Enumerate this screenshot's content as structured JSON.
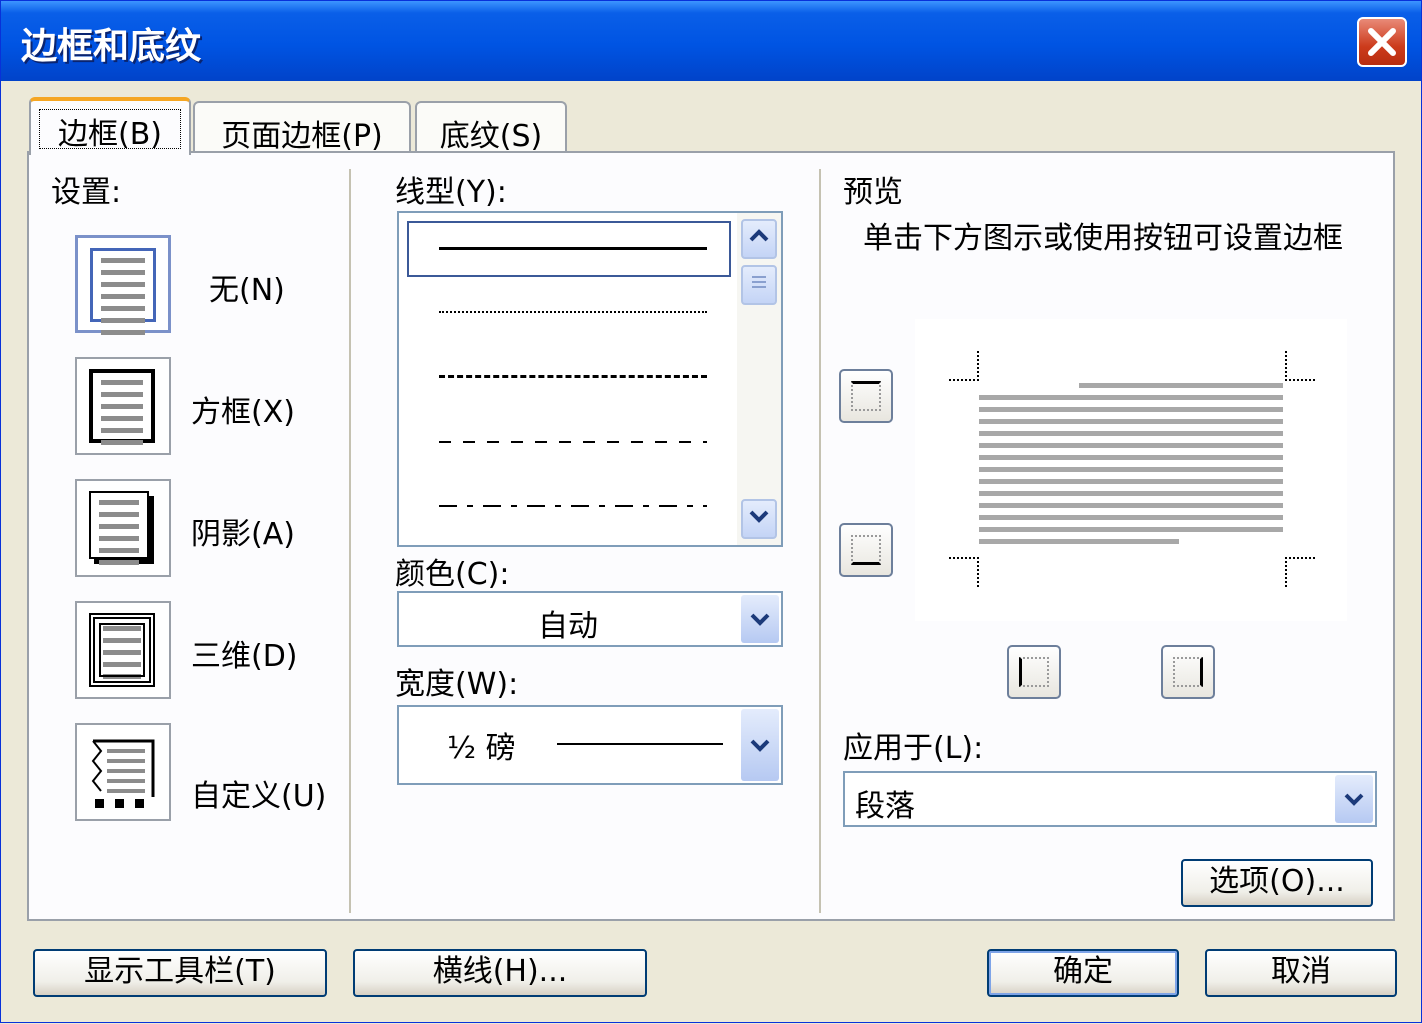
{
  "window": {
    "title": "边框和底纹"
  },
  "tabs": [
    {
      "label": "边框(B)",
      "active": true
    },
    {
      "label": "页面边框(P)",
      "active": false
    },
    {
      "label": "底纹(S)",
      "active": false
    }
  ],
  "settings": {
    "label": "设置:",
    "options": [
      {
        "label": "无(N)",
        "selected": true
      },
      {
        "label": "方框(X)",
        "selected": false
      },
      {
        "label": "阴影(A)",
        "selected": false
      },
      {
        "label": "三维(D)",
        "selected": false
      },
      {
        "label": "自定义(U)",
        "selected": false
      }
    ]
  },
  "style": {
    "label": "线型(Y):",
    "items": [
      "solid",
      "dotted",
      "dashed-small",
      "dashed",
      "dash-dot"
    ],
    "selected_index": 0
  },
  "color": {
    "label": "颜色(C):",
    "value": "自动"
  },
  "width": {
    "label": "宽度(W):",
    "value": "½ 磅"
  },
  "preview": {
    "label": "预览",
    "hint": "单击下方图示或使用按钮可设置边框"
  },
  "apply_to": {
    "label": "应用于(L):",
    "value": "段落"
  },
  "buttons": {
    "options": "选项(O)...",
    "show_toolbar": "显示工具栏(T)",
    "horizontal_line": "横线(H)...",
    "ok": "确定",
    "cancel": "取消"
  },
  "colors": {
    "titlebar": "#0054e3",
    "dialog_bg": "#ece9d8",
    "accent": "#f5a623"
  }
}
